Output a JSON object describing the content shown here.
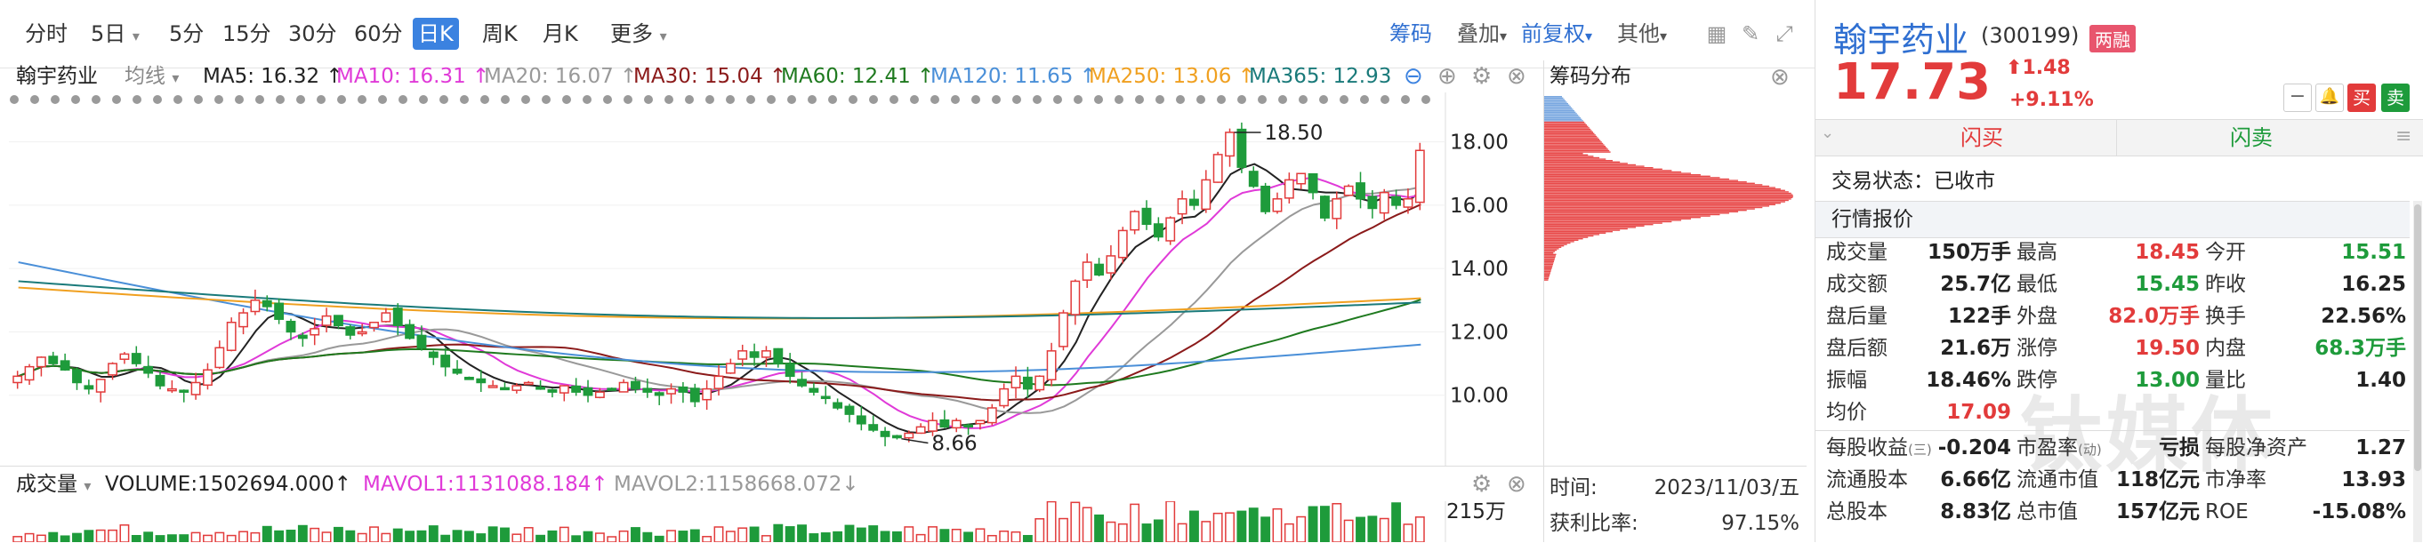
{
  "toolbar": {
    "periods": [
      "分时",
      "5日",
      "5分",
      "15分",
      "30分",
      "60分",
      "日K",
      "周K",
      "月K",
      "更多"
    ],
    "active_period": "日K",
    "right_items": {
      "chips": "筹码",
      "overlay": "叠加",
      "adjust": "前复权",
      "other": "其他"
    }
  },
  "ma_legend": {
    "stock_name": "翰宇药业",
    "ma_type": "均线",
    "items": [
      {
        "label": "MA5: 16.32 ↑",
        "color": "#222222"
      },
      {
        "label": "MA10: 16.31 ↑",
        "color": "#e03ad8"
      },
      {
        "label": "MA20: 16.07 ↑",
        "color": "#999999"
      },
      {
        "label": "MA30: 15.04 ↑",
        "color": "#8b1a1a"
      },
      {
        "label": "MA60: 12.41 ↑",
        "color": "#1f7a1f"
      },
      {
        "label": "MA120: 11.65 ↑",
        "color": "#4a8fd8"
      },
      {
        "label": "MA250: 13.06 ↑",
        "color": "#f0a020"
      },
      {
        "label": "MA365: 12.93",
        "color": "#1a7a7a"
      }
    ]
  },
  "chart_data": {
    "type": "candlestick",
    "y_ticks": [
      "18.00",
      "16.00",
      "14.00",
      "12.00",
      "10.00"
    ],
    "ylim": [
      8.0,
      19.0
    ],
    "annotations": {
      "high": "18.50",
      "low": "8.66"
    },
    "price_path": [
      10.6,
      10.9,
      11.2,
      11.0,
      10.8,
      10.4,
      10.2,
      10.5,
      11.0,
      11.3,
      11.0,
      10.7,
      10.3,
      10.2,
      10.1,
      10.4,
      10.8,
      11.5,
      12.3,
      12.6,
      13.0,
      12.8,
      12.4,
      12.0,
      11.8,
      12.1,
      12.5,
      12.2,
      11.9,
      12.0,
      12.3,
      12.6,
      12.2,
      11.8,
      11.5,
      11.2,
      10.9,
      10.7,
      10.5,
      10.4,
      10.3,
      10.2,
      10.3,
      10.4,
      10.2,
      10.1,
      10.3,
      10.1,
      10.0,
      10.1,
      10.2,
      10.4,
      10.2,
      10.1,
      10.0,
      10.2,
      10.1,
      9.8,
      10.2,
      10.6,
      11.0,
      11.4,
      11.2,
      11.4,
      11.0,
      10.6,
      10.3,
      10.1,
      9.9,
      9.6,
      9.4,
      9.1,
      8.9,
      8.7,
      8.66,
      8.8,
      9.0,
      9.2,
      9.0,
      9.2,
      9.0,
      9.2,
      9.6,
      10.2,
      10.6,
      10.2,
      10.6,
      11.4,
      12.6,
      13.6,
      14.2,
      13.8,
      14.4,
      15.2,
      15.8,
      15.4,
      15.0,
      15.6,
      16.2,
      16.0,
      16.8,
      17.6,
      18.3,
      17.2,
      16.6,
      15.8,
      16.2,
      16.8,
      17.0,
      16.4,
      15.6,
      16.2,
      16.6,
      16.2,
      15.9,
      16.4,
      16.0,
      16.2,
      17.73
    ],
    "highs": [
      18.45
    ],
    "ma_series": [
      "MA5",
      "MA10",
      "MA20",
      "MA30",
      "MA60",
      "MA120",
      "MA250",
      "MA365"
    ]
  },
  "volume": {
    "title": "成交量",
    "vol": "VOLUME:1502694.000↑",
    "mavol1": "MAVOL1:1131088.184↑",
    "mavol2": "MAVOL2:1158668.072↓",
    "axis_label": "215万"
  },
  "chips": {
    "title": "筹码分布",
    "time_label": "时间:",
    "time_value": "2023/11/03/五",
    "ratio_label": "获利比率:",
    "ratio_value": "97.15%"
  },
  "quote": {
    "name": "翰宇药业",
    "code": "(300199)",
    "badge": "两融",
    "price": "17.73",
    "change": "1.48",
    "change_pct": "+9.11%",
    "buy_btn": "买",
    "sell_btn": "卖",
    "flash_buy": "闪买",
    "flash_sell": "闪卖",
    "status": "交易状态：已收市",
    "section_title": "行情报价",
    "watermark": "钛媒体",
    "rows": [
      [
        {
          "l": "成交量",
          "v": "150万手",
          "c": "blk"
        },
        {
          "l": "最高",
          "v": "18.45",
          "c": "red"
        },
        {
          "l": "今开",
          "v": "15.51",
          "c": "green"
        }
      ],
      [
        {
          "l": "成交额",
          "v": "25.7亿",
          "c": "blk"
        },
        {
          "l": "最低",
          "v": "15.45",
          "c": "green"
        },
        {
          "l": "昨收",
          "v": "16.25",
          "c": "blk"
        }
      ],
      [
        {
          "l": "盘后量",
          "v": "122手",
          "c": "blk"
        },
        {
          "l": "外盘",
          "v": "82.0万手",
          "c": "red"
        },
        {
          "l": "换手",
          "v": "22.56%",
          "c": "blk"
        }
      ],
      [
        {
          "l": "盘后额",
          "v": "21.6万",
          "c": "blk"
        },
        {
          "l": "涨停",
          "v": "19.50",
          "c": "red"
        },
        {
          "l": "内盘",
          "v": "68.3万手",
          "c": "green"
        }
      ],
      [
        {
          "l": "振幅",
          "v": "18.46%",
          "c": "blk"
        },
        {
          "l": "跌停",
          "v": "13.00",
          "c": "green"
        },
        {
          "l": "量比",
          "v": "1.40",
          "c": "blk"
        }
      ],
      [
        {
          "l": "均价",
          "v": "17.09",
          "c": "red"
        },
        {
          "l": "",
          "v": "",
          "c": "blk"
        },
        {
          "l": "",
          "v": "",
          "c": "blk"
        }
      ]
    ],
    "rows2": [
      [
        {
          "l": "每股收益",
          "sub": "(三)",
          "v": "-0.204"
        },
        {
          "l": "市盈率",
          "sub": "(动)",
          "v": "亏损"
        },
        {
          "l": "每股净资产",
          "sub": "",
          "v": "1.27"
        }
      ],
      [
        {
          "l": "流通股本",
          "sub": "",
          "v": "6.66亿"
        },
        {
          "l": "流通市值",
          "sub": "",
          "v": "118亿元"
        },
        {
          "l": "市净率",
          "sub": "",
          "v": "13.93"
        }
      ],
      [
        {
          "l": "总股本",
          "sub": "",
          "v": "8.83亿"
        },
        {
          "l": "总市值",
          "sub": "",
          "v": "157亿元"
        },
        {
          "l": "ROE",
          "sub": "",
          "v": "-15.08%"
        }
      ]
    ]
  }
}
